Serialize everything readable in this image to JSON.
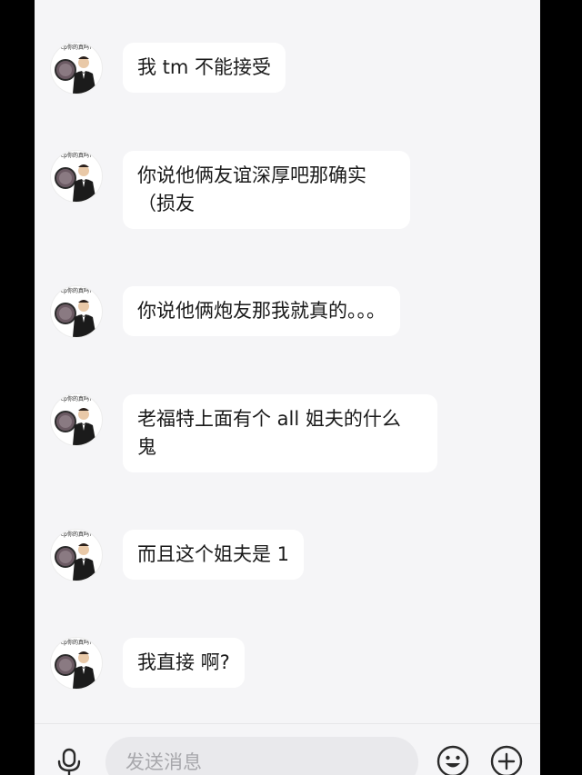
{
  "avatar": {
    "caption": "cp你的真吗?"
  },
  "messages": [
    {
      "text": "我 tm 不能接受"
    },
    {
      "text": "你说他俩友谊深厚吧那确实\n（损友"
    },
    {
      "text": "你说他俩炮友那我就真的。。。"
    },
    {
      "text": "老福特上面有个 all 姐夫的什么\n鬼"
    },
    {
      "text": "而且这个姐夫是 1"
    },
    {
      "text": "我直接 啊?"
    }
  ],
  "input": {
    "placeholder": "发送消息",
    "value": ""
  },
  "icons": {
    "voice": "microphone-icon",
    "emoji": "smiley-face-icon",
    "more": "plus-circle-icon"
  }
}
